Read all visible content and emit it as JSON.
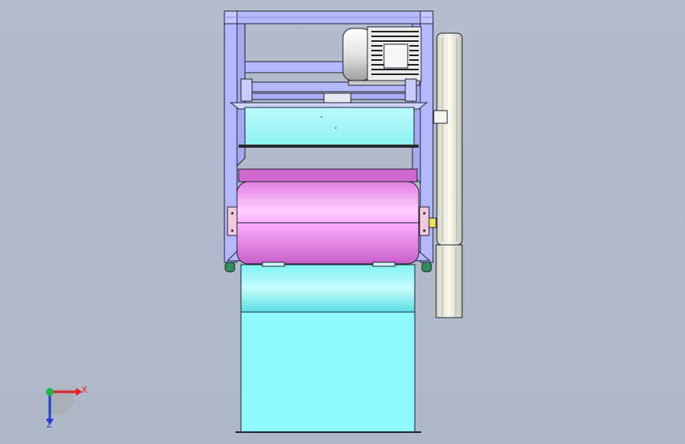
{
  "viewport": {
    "background_top": "#b3bdcb",
    "background_bottom": "#aeb8c8"
  },
  "colors": {
    "frame": "#b3b8ff",
    "frame_dark": "#9aa0ea",
    "outline": "#1f2233",
    "hopper_cyan": "#8ff6f7",
    "hopper_cyan_light": "#b9fbfb",
    "hopper_cyan_dark": "#5fe3e6",
    "drum_magenta": "#f38af3",
    "drum_magenta_light": "#ffc2ff",
    "drum_top": "#c866c8",
    "motor_light": "#f2f2f2",
    "motor_dark": "#2a2a2a",
    "pulley": "#f0f0e6",
    "pulley_shade": "#c9c9bc",
    "caster_green": "#2f8f5a",
    "yellow_accent": "#f0e15a",
    "axis_x": "#e8202a",
    "axis_y": "#21b24a",
    "axis_z": "#1f3dd1"
  },
  "icons": {
    "motor": "electric-motor-icon",
    "pulley": "belt-pulley-icon",
    "triad": "coordinate-axes-icon"
  },
  "triad": {
    "x_label": "X",
    "z_label": "Z"
  }
}
